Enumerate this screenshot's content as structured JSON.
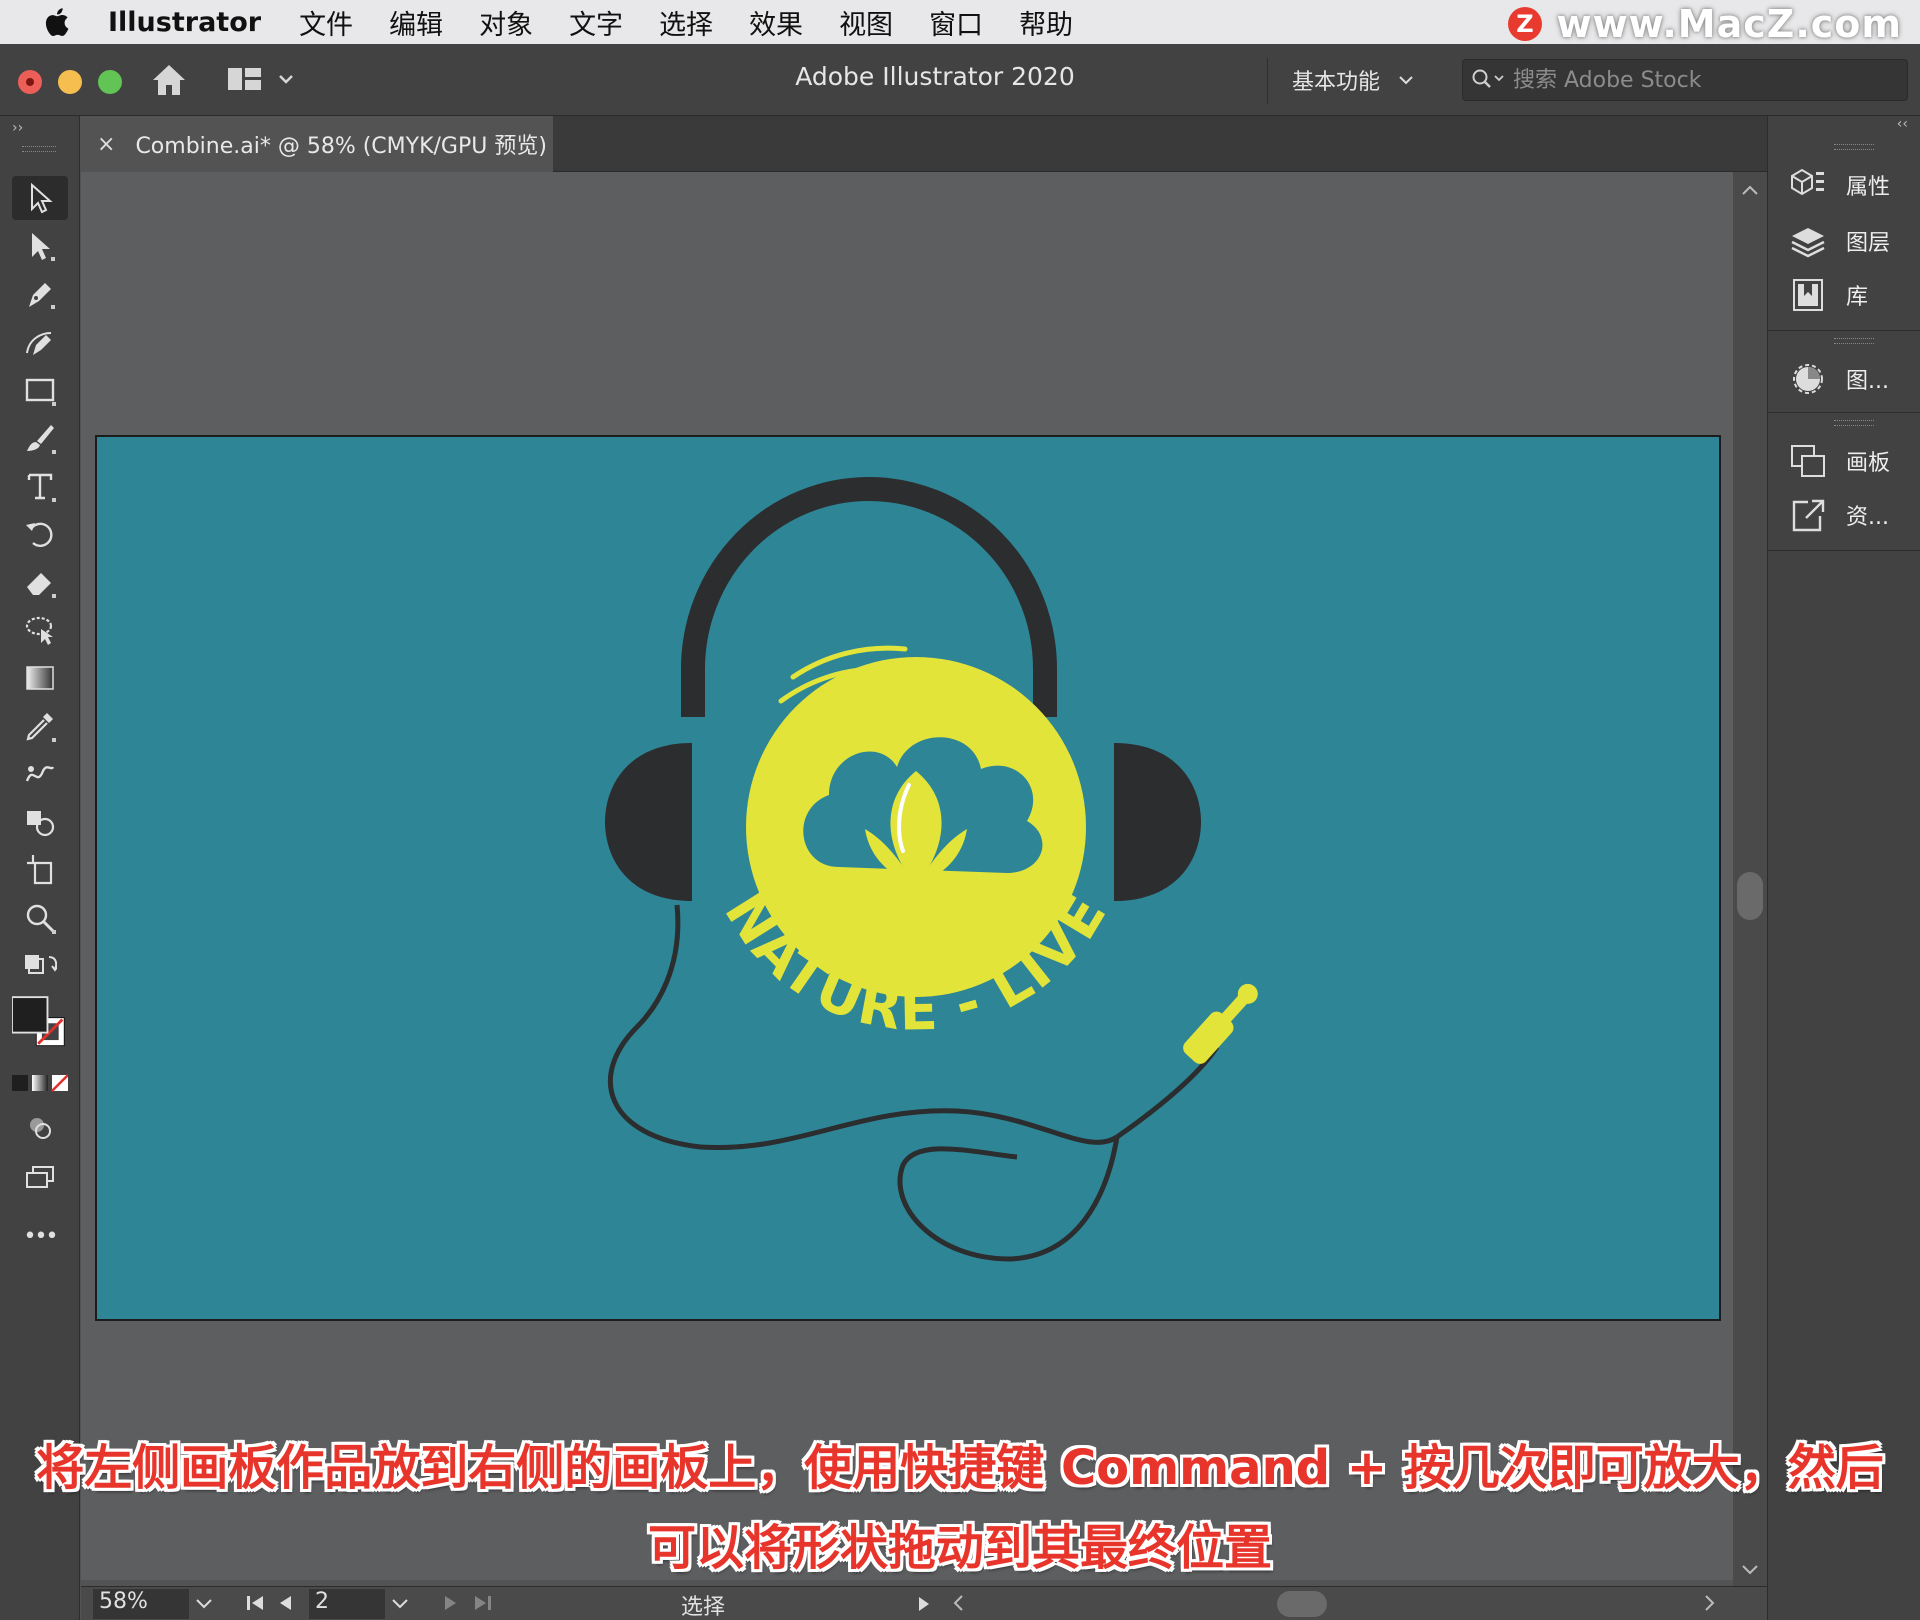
{
  "menubar": {
    "app_name": "Illustrator",
    "items": [
      "文件",
      "编辑",
      "对象",
      "文字",
      "选择",
      "效果",
      "视图",
      "窗口",
      "帮助"
    ],
    "watermark": "www.MacZ.com",
    "watermark_badge": "Z"
  },
  "titlebar": {
    "title": "Adobe Illustrator 2020",
    "workspace": "基本功能",
    "search_placeholder": "搜索 Adobe Stock"
  },
  "document_tab": {
    "close": "×",
    "label": "Combine.ai* @ 58% (CMYK/GPU 预览)"
  },
  "toolbar": {
    "collapse": "››",
    "tools": [
      "selection-tool",
      "direct-selection-tool",
      "pen-tool",
      "curvature-tool",
      "rectangle-tool",
      "paintbrush-tool",
      "type-tool",
      "rotate-tool",
      "eraser-tool",
      "lasso-tool",
      "gradient-tool",
      "eyedropper-tool",
      "blend-tool",
      "shape-builder-tool",
      "artboard-tool",
      "zoom-tool"
    ],
    "more": "•••"
  },
  "artwork": {
    "background": "#2e8596",
    "accent": "#e2e43a",
    "dark": "#2b2d2f",
    "text": "NATURE - LIVE"
  },
  "statusbar": {
    "zoom": "58%",
    "artboard_number": "2",
    "mode": "选择"
  },
  "dock": {
    "collapse": "‹‹",
    "items": [
      {
        "icon": "properties-icon",
        "label": "属性"
      },
      {
        "icon": "layers-icon",
        "label": "图层"
      },
      {
        "icon": "libraries-icon",
        "label": "库"
      },
      {
        "icon": "graphic-styles-icon",
        "label": "图..."
      },
      {
        "icon": "artboards-icon",
        "label": "画板"
      },
      {
        "icon": "asset-export-icon",
        "label": "资..."
      }
    ]
  },
  "caption": {
    "line1": "将左侧画板作品放到右侧的画板上，使用快捷键 Command + 按几次即可放大，然后",
    "line2": "可以将形状拖动到其最终位置"
  }
}
